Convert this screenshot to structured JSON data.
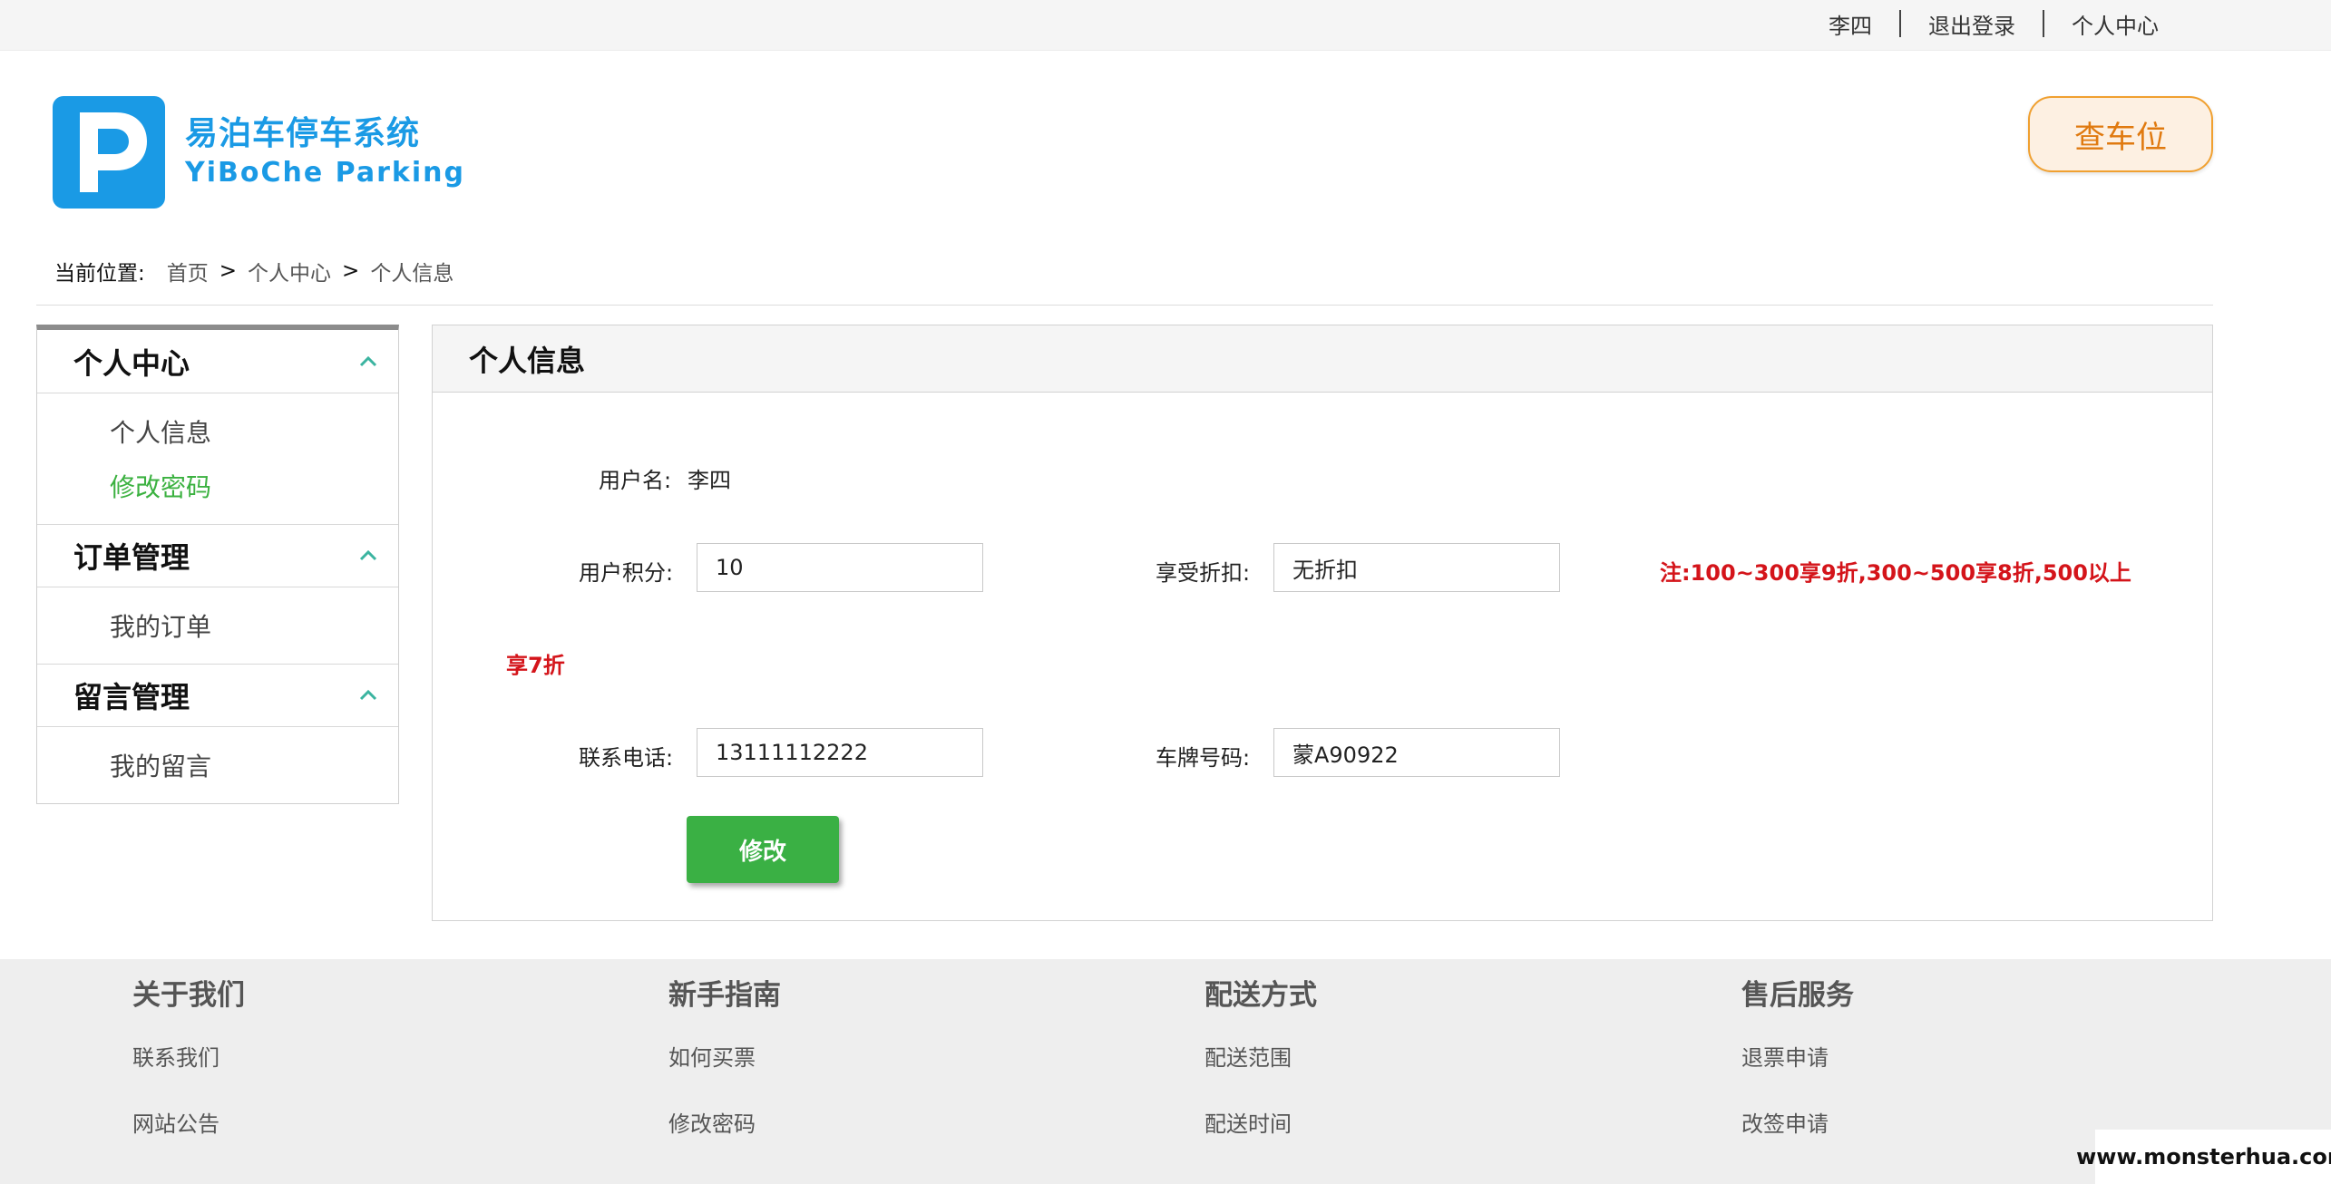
{
  "topbar": {
    "username": "李四",
    "logout": "退出登录",
    "personal_center": "个人中心"
  },
  "header": {
    "logo_letter": "P",
    "logo_cn": "易泊车停车系统",
    "logo_en": "YiBoChe  Parking",
    "find_spot_button": "查车位"
  },
  "breadcrumb": {
    "label": "当前位置:",
    "items": [
      "首页",
      "个人中心",
      "个人信息"
    ],
    "separator": ">"
  },
  "sidebar": {
    "sections": [
      {
        "title": "个人中心",
        "items": [
          "个人信息",
          "修改密码"
        ]
      },
      {
        "title": "订单管理",
        "items": [
          "我的订单"
        ]
      },
      {
        "title": "留言管理",
        "items": [
          "我的留言"
        ]
      }
    ],
    "active_item": "修改密码"
  },
  "panel": {
    "title": "个人信息",
    "username_label": "用户名:",
    "username_value": "李四",
    "points_label": "用户积分:",
    "points_value": "10",
    "discount_label": "享受折扣:",
    "discount_value": "无折扣",
    "note_line1": "注:100~300享9折,300~500享8折,500以上",
    "note_line2": "享7折",
    "phone_label": "联系电话:",
    "phone_value": "13111112222",
    "plate_label": "车牌号码:",
    "plate_value": "蒙A90922",
    "submit_label": "修改"
  },
  "footer": {
    "columns": [
      {
        "title": "关于我们",
        "links": [
          "联系我们",
          "网站公告"
        ]
      },
      {
        "title": "新手指南",
        "links": [
          "如何买票",
          "修改密码"
        ]
      },
      {
        "title": "配送方式",
        "links": [
          "配送范围",
          "配送时间"
        ]
      },
      {
        "title": "售后服务",
        "links": [
          "退票申请",
          "改签申请"
        ]
      }
    ]
  },
  "watermark": "www.monsterhua.com",
  "colors": {
    "brand_blue": "#1a9ae5",
    "accent_green": "#3ab044",
    "note_red": "#d4141a",
    "find_orange": "#e07a10"
  },
  "icons": [
    "parking-logo-icon",
    "chevron-up-icon"
  ]
}
